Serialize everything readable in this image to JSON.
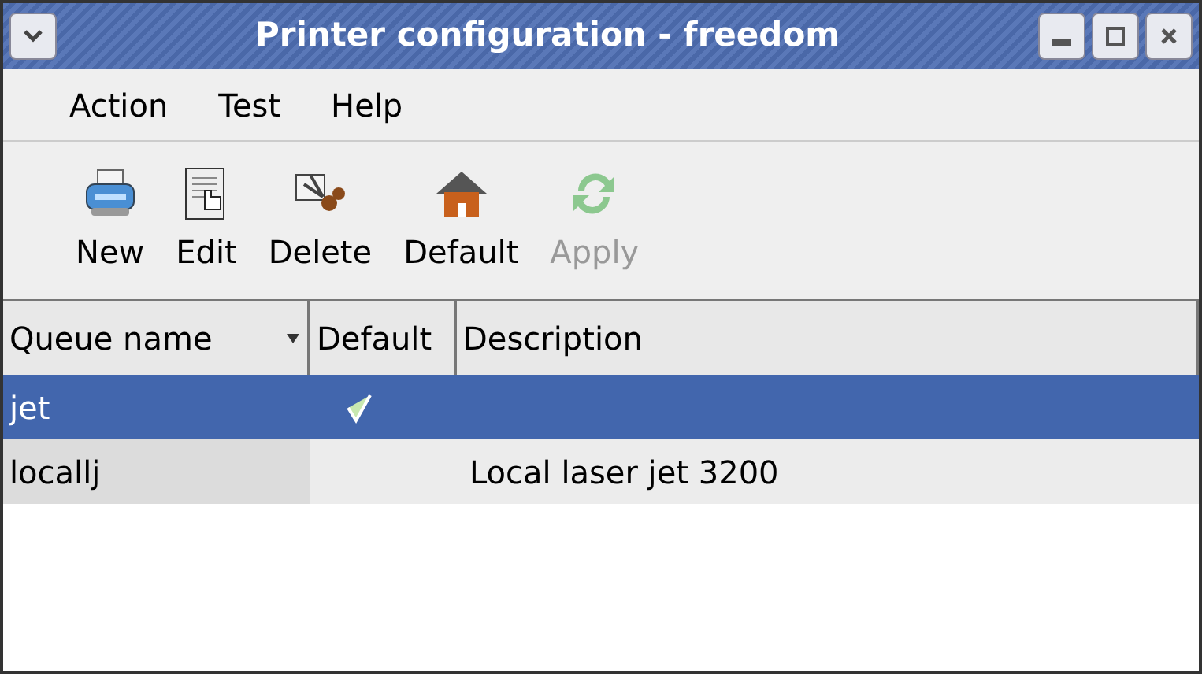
{
  "window": {
    "title": "Printer configuration - freedom"
  },
  "menu": [
    {
      "label": "Action"
    },
    {
      "label": "Test"
    },
    {
      "label": "Help"
    }
  ],
  "toolbar": [
    {
      "label": "New",
      "kind": "printer",
      "disabled": false
    },
    {
      "label": "Edit",
      "kind": "edit",
      "disabled": false
    },
    {
      "label": "Delete",
      "kind": "delete",
      "disabled": false
    },
    {
      "label": "Default",
      "kind": "home",
      "disabled": false
    },
    {
      "label": "Apply",
      "kind": "apply",
      "disabled": true
    }
  ],
  "table": {
    "columns": [
      {
        "label": "Queue name",
        "sorted": true
      },
      {
        "label": "Default",
        "sorted": false
      },
      {
        "label": "Description",
        "sorted": false
      }
    ],
    "rows": [
      {
        "queue": "jet",
        "default": true,
        "selected": true
      },
      {
        "queue": "locallj",
        "default": false,
        "description": "Local laser jet 3200",
        "selected": false
      }
    ]
  }
}
